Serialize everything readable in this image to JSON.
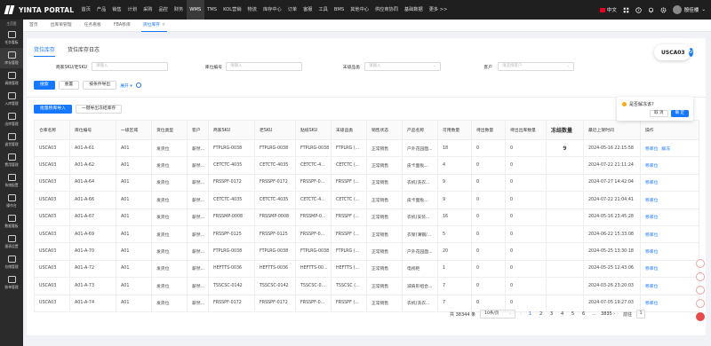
{
  "brand": {
    "name": "YINTA PORTAL"
  },
  "top_menu": [
    "首页",
    "产品",
    "销售",
    "计划",
    "采购",
    "品控",
    "财务",
    "WMS",
    "TMS",
    "KOL营销",
    "物流",
    "库存中心",
    "订单",
    "客服",
    "工具",
    "BMS",
    "其他中心",
    "供应商协同",
    "基础数据",
    "更多 >>"
  ],
  "top_menu_active": "WMS",
  "top_right": {
    "lang": "中文",
    "user": "殷佳楼"
  },
  "sidebar": {
    "top_label": "主页签",
    "items": [
      "任务看板",
      "库存管理",
      "调拨管理",
      "入库管理",
      "出库管理",
      "退货管理",
      "费用管理",
      "系统配置",
      "操作台",
      "数据看板",
      "报表设置",
      "仓储管理",
      "账单管理"
    ],
    "active": "库存管理"
  },
  "tabs": [
    "首页",
    "出库单管理",
    "任务看板",
    "FBA移库",
    "货位库存"
  ],
  "active_tab": "货位库存",
  "subtabs": [
    "货位库存",
    "货位库存日志"
  ],
  "active_subtab": "货位库存",
  "filters": {
    "sku": {
      "label": "商家SKU/老SKU",
      "placeholder": "请输入"
    },
    "location": {
      "label": "库位编号",
      "placeholder": "请输入"
    },
    "fnsku": {
      "label": "末级品类",
      "placeholder": "请输入"
    },
    "customer": {
      "label": "客户",
      "placeholder": "请选择客户"
    }
  },
  "buttons": {
    "search": "搜索",
    "reset": "重置",
    "export": "按条件导出",
    "expand": "展开",
    "batch_freeze": "批量移库导入",
    "one_click": "一键导出冻结库存"
  },
  "warehouse": {
    "code": "USCA03"
  },
  "popconfirm": {
    "message": "是否解冻该?",
    "cancel": "取 消",
    "ok": "确 定"
  },
  "table": {
    "headers": [
      "仓库名称",
      "库位编号",
      "一级区域",
      "货位类型",
      "客户",
      "商家SKU",
      "老SKU",
      "贴纸SKU",
      "末级品类",
      "销售状态",
      "产品名称",
      "可用数量",
      "待出数量",
      "待出出库数量",
      "冻结数量",
      "最近上架时间",
      "操作"
    ],
    "rows": [
      [
        "USCA03",
        "A01-A-61",
        "A01",
        "发货位",
        "薪然...",
        "FTPLRG-0038",
        "FTPLRG-0038",
        "FTPLRG-0038",
        "FTPLRG (...",
        "正常销售",
        "户外花园面...",
        "18",
        "0",
        "0",
        "9",
        "2024-05-16 22:15:58",
        "移库位",
        "解冻"
      ],
      [
        "USCA03",
        "A01-A-62",
        "A01",
        "发货位",
        "薪然...",
        "CETCTC-4035",
        "CETCTC-4035",
        "CETCTC-4...",
        "CETCTC (...",
        "正常销售",
        "皮卡面板...",
        "4",
        "0",
        "0",
        "",
        "2024-07-22 21:11:24",
        "移库位",
        ""
      ],
      [
        "USCA03",
        "A01-A-64",
        "A01",
        "发货位",
        "薪然...",
        "FRSSPF-0172",
        "FRSSPF-0172",
        "FRSSPF-0...",
        "FRSSPF (...",
        "正常销售",
        "衣机(洗衣...",
        "9",
        "0",
        "0",
        "",
        "2024-07-27 14:42:04",
        "移库位",
        ""
      ],
      [
        "USCA03",
        "A01-A-66",
        "A01",
        "发货位",
        "薪然...",
        "CETCTC-4035",
        "CETCTC-4035",
        "CETCTC-4...",
        "CETCTC (...",
        "正常销售",
        "皮卡面板...",
        "9",
        "0",
        "0",
        "",
        "2024-07-22 21:04:41",
        "移库位",
        ""
      ],
      [
        "USCA03",
        "A01-A-67",
        "A01",
        "发货位",
        "薪然...",
        "FRSSMP-0008",
        "FRSSMP-0008",
        "FRSSMP-0...",
        "FRSSPF (...",
        "正常销售",
        "衣机(安装...",
        "16",
        "0",
        "0",
        "",
        "2024-05-16 23:45:28",
        "移库位",
        ""
      ],
      [
        "USCA03",
        "A01-A-69",
        "A01",
        "发货位",
        "薪然...",
        "FRSSPF-0125",
        "FRSSPF-0125",
        "FRSSPF-0...",
        "FRSSPF (...",
        "正常销售",
        "衣架(薄钢/...",
        "5",
        "0",
        "0",
        "",
        "2024-06-22 15:33:08",
        "移库位",
        ""
      ],
      [
        "USCA03",
        "A01-A-70",
        "A01",
        "发货位",
        "薪然...",
        "FTPLRG-0038",
        "FTPLRG-0038",
        "FTPLRG-0038",
        "FTPLRG (...",
        "正常销售",
        "户外花园面...",
        "20",
        "0",
        "0",
        "",
        "2024-05-25 13:30:18",
        "移库位",
        ""
      ],
      [
        "USCA03",
        "A01-A-72",
        "A01",
        "发货位",
        "薪然...",
        "HEFTTS-0036",
        "HEFTTS-0036",
        "HEFTTS-00...",
        "HEFTTS (...",
        "正常销售",
        "电视柜",
        "1",
        "0",
        "0",
        "",
        "2024-05-25 12:43:06",
        "移库位",
        ""
      ],
      [
        "USCA03",
        "A01-A-73",
        "A01",
        "发货位",
        "薪然...",
        "TSSCSC-0142",
        "TSSCSC-0142",
        "TSSCSC-0...",
        "TSSCSC (...",
        "正常销售",
        "减肩形组合...",
        "7",
        "0",
        "0",
        "",
        "2024-03-26 23:20:03",
        "移库位",
        ""
      ],
      [
        "USCA03",
        "A01-A-74",
        "A01",
        "发货位",
        "薪然...",
        "FRSSPF-0172",
        "FRSSPF-0172",
        "FRSSPF-0...",
        "FRSSPF (...",
        "正常销售",
        "衣机(洗衣...",
        "7",
        "0",
        "0",
        "",
        "2024-07-05 19:27:03",
        "移库位",
        ""
      ]
    ]
  },
  "pagination": {
    "total": "共 38344 条",
    "page_size": "10条/页",
    "pages": [
      "1",
      "2",
      "3",
      "4",
      "5",
      "6",
      "...",
      "3835"
    ],
    "active": "1",
    "jump_label": "前往",
    "jump_value": "1"
  }
}
